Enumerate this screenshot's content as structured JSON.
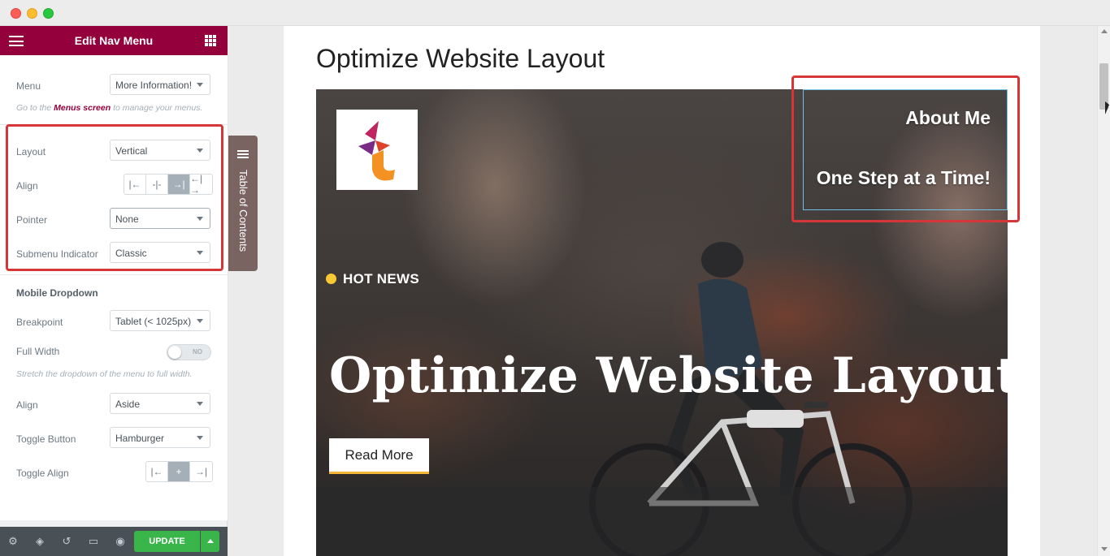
{
  "panel": {
    "header_title": "Edit Nav Menu",
    "menu_label": "Menu",
    "menu_value": "More Information!",
    "menu_hint_prefix": "Go to the",
    "menu_hint_link": "Menus screen",
    "menu_hint_suffix": "to manage your menus.",
    "layout_label": "Layout",
    "layout_value": "Vertical",
    "align_label": "Align",
    "align_options": [
      "left",
      "center",
      "right",
      "justify"
    ],
    "align_active": "right",
    "pointer_label": "Pointer",
    "pointer_value": "None",
    "submenu_label": "Submenu Indicator",
    "submenu_value": "Classic",
    "mobile_section": "Mobile Dropdown",
    "breakpoint_label": "Breakpoint",
    "breakpoint_value": "Tablet (< 1025px)",
    "fullwidth_label": "Full Width",
    "fullwidth_toggle": "NO",
    "fullwidth_hint": "Stretch the dropdown of the menu to full width.",
    "mobile_align_label": "Align",
    "mobile_align_value": "Aside",
    "toggle_button_label": "Toggle Button",
    "toggle_button_value": "Hamburger",
    "toggle_align_label": "Toggle Align",
    "toggle_align_active": "center",
    "update_label": "UPDATE"
  },
  "toc": {
    "label": "Table of Contents"
  },
  "preview": {
    "page_title": "Optimize Website Layout",
    "nav_items": [
      "About Me",
      "One Step at a Time!"
    ],
    "badge": "HOT NEWS",
    "hero_title": "Optimize Website Layout",
    "button": "Read More"
  },
  "colors": {
    "header": "#93003c",
    "highlight": "#d63638",
    "update": "#39b54a",
    "toc": "#7a6462",
    "badge_dot": "#f9c935",
    "button_underline": "#f4b738",
    "nav_outline": "#6ec1e4"
  }
}
